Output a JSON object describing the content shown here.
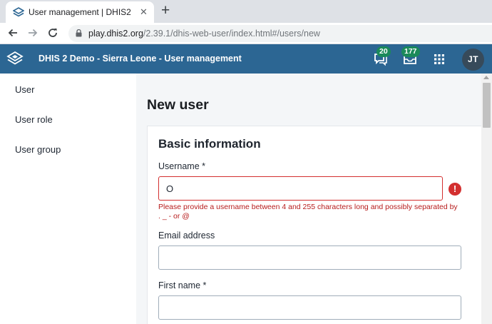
{
  "browser": {
    "tab_title": "User management | DHIS2",
    "tab_close": "✕",
    "new_tab": "+",
    "url_host": "play.dhis2.org",
    "url_path": "/2.39.1/dhis-web-user/index.html#/users/new",
    "icons": [
      "dhis2-favicon",
      "back-arrow-icon",
      "forward-arrow-icon",
      "reload-icon",
      "lock-icon"
    ]
  },
  "header": {
    "title": "DHIS 2 Demo - Sierra Leone - User management",
    "interpretations_count": "20",
    "messages_count": "177",
    "avatar_initials": "JT",
    "bg_color": "#2c6693",
    "badge_color": "#1b8a5a"
  },
  "sidebar": {
    "items": [
      {
        "label": "User"
      },
      {
        "label": "User role"
      },
      {
        "label": "User group"
      }
    ]
  },
  "main": {
    "page_title": "New user",
    "section_title": "Basic information",
    "fields": {
      "username": {
        "label": "Username *",
        "value": "O",
        "error": "Please provide a username between 4 and 255 characters long and possibly separated by . _ - or @"
      },
      "email": {
        "label": "Email address",
        "value": ""
      },
      "first_name": {
        "label": "First name *",
        "value": ""
      }
    },
    "error_icon": "!",
    "error_color": "#d32f2f"
  }
}
